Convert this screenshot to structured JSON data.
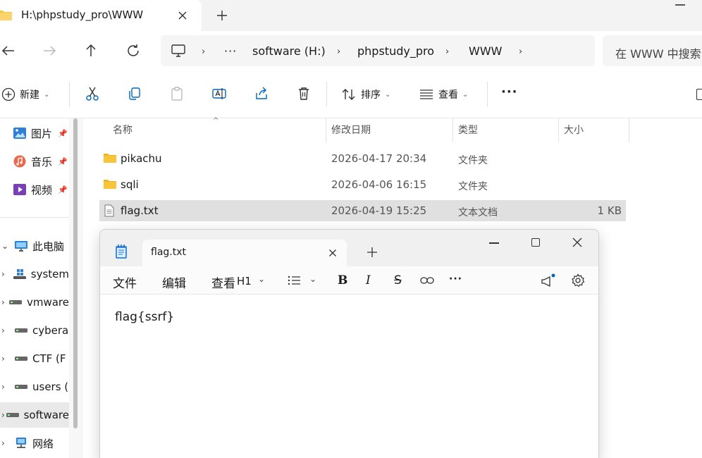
{
  "window": {
    "tab_title": "H:\\phpstudy_pro\\WWW"
  },
  "address": {
    "ellipsis": "···",
    "crumbs": [
      "software (H:)",
      "phpstudy_pro",
      "WWW"
    ],
    "search_placeholder": "在 WWW 中搜索"
  },
  "toolbar": {
    "new_label": "新建",
    "sort_label": "排序",
    "view_label": "查看",
    "more_label": "···"
  },
  "sidebar": {
    "quick": [
      {
        "label": "图片",
        "icon": "pictures-icon"
      },
      {
        "label": "音乐",
        "icon": "music-icon"
      },
      {
        "label": "视频",
        "icon": "videos-icon"
      }
    ],
    "this_pc": "此电脑",
    "drives": [
      {
        "label": "system"
      },
      {
        "label": "vmware"
      },
      {
        "label": "cyberа"
      },
      {
        "label": "CTF (F"
      },
      {
        "label": "users ("
      },
      {
        "label": "software"
      }
    ],
    "network": "网络"
  },
  "filelist": {
    "columns": {
      "name": "名称",
      "date": "修改日期",
      "type": "类型",
      "size": "大小"
    },
    "rows": [
      {
        "name": "pikachu",
        "date": "2026-04-17 20:34",
        "type": "文件夹",
        "size": "",
        "icon": "folder-icon"
      },
      {
        "name": "sqli",
        "date": "2026-04-06 16:15",
        "type": "文件夹",
        "size": "",
        "icon": "folder-icon"
      },
      {
        "name": "flag.txt",
        "date": "2026-04-19 15:25",
        "type": "文本文档",
        "size": "1 KB",
        "icon": "text-file-icon",
        "selected": true
      }
    ]
  },
  "notepad": {
    "tab_title": "flag.txt",
    "menu": {
      "file": "文件",
      "edit": "编辑",
      "view": "查看",
      "heading": "H1",
      "more": "···"
    },
    "content": "flag{ssrf}"
  },
  "colors": {
    "folder_yellow": "#F8C53A",
    "selection_gray": "#e0e0e0",
    "accent_blue": "#0067c0"
  }
}
